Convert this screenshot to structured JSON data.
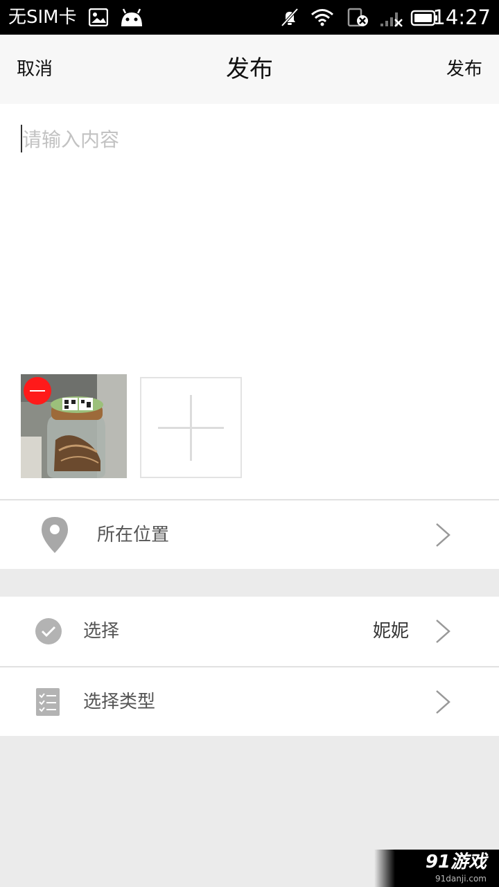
{
  "status_bar": {
    "carrier": "无SIM卡",
    "time": "14:27",
    "icons": [
      "image-notification-icon",
      "android-icon",
      "mute-icon",
      "wifi-icon",
      "sim-error-icon",
      "no-signal-icon",
      "battery-icon"
    ]
  },
  "header": {
    "cancel_label": "取消",
    "title": "发布",
    "publish_label": "发布"
  },
  "compose": {
    "content_placeholder": "请输入内容",
    "photos_count": 1
  },
  "options": {
    "location_label": "所在位置",
    "select_label": "选择",
    "select_value": "妮妮",
    "type_label": "选择类型"
  },
  "watermark": {
    "logo": "91游戏",
    "url": "91danji.com"
  },
  "colors": {
    "accent_remove": "#ff1a1a",
    "nav_background": "#f7f7f7",
    "page_background": "#ebebeb",
    "icon_gray": "#a8a8a8"
  }
}
